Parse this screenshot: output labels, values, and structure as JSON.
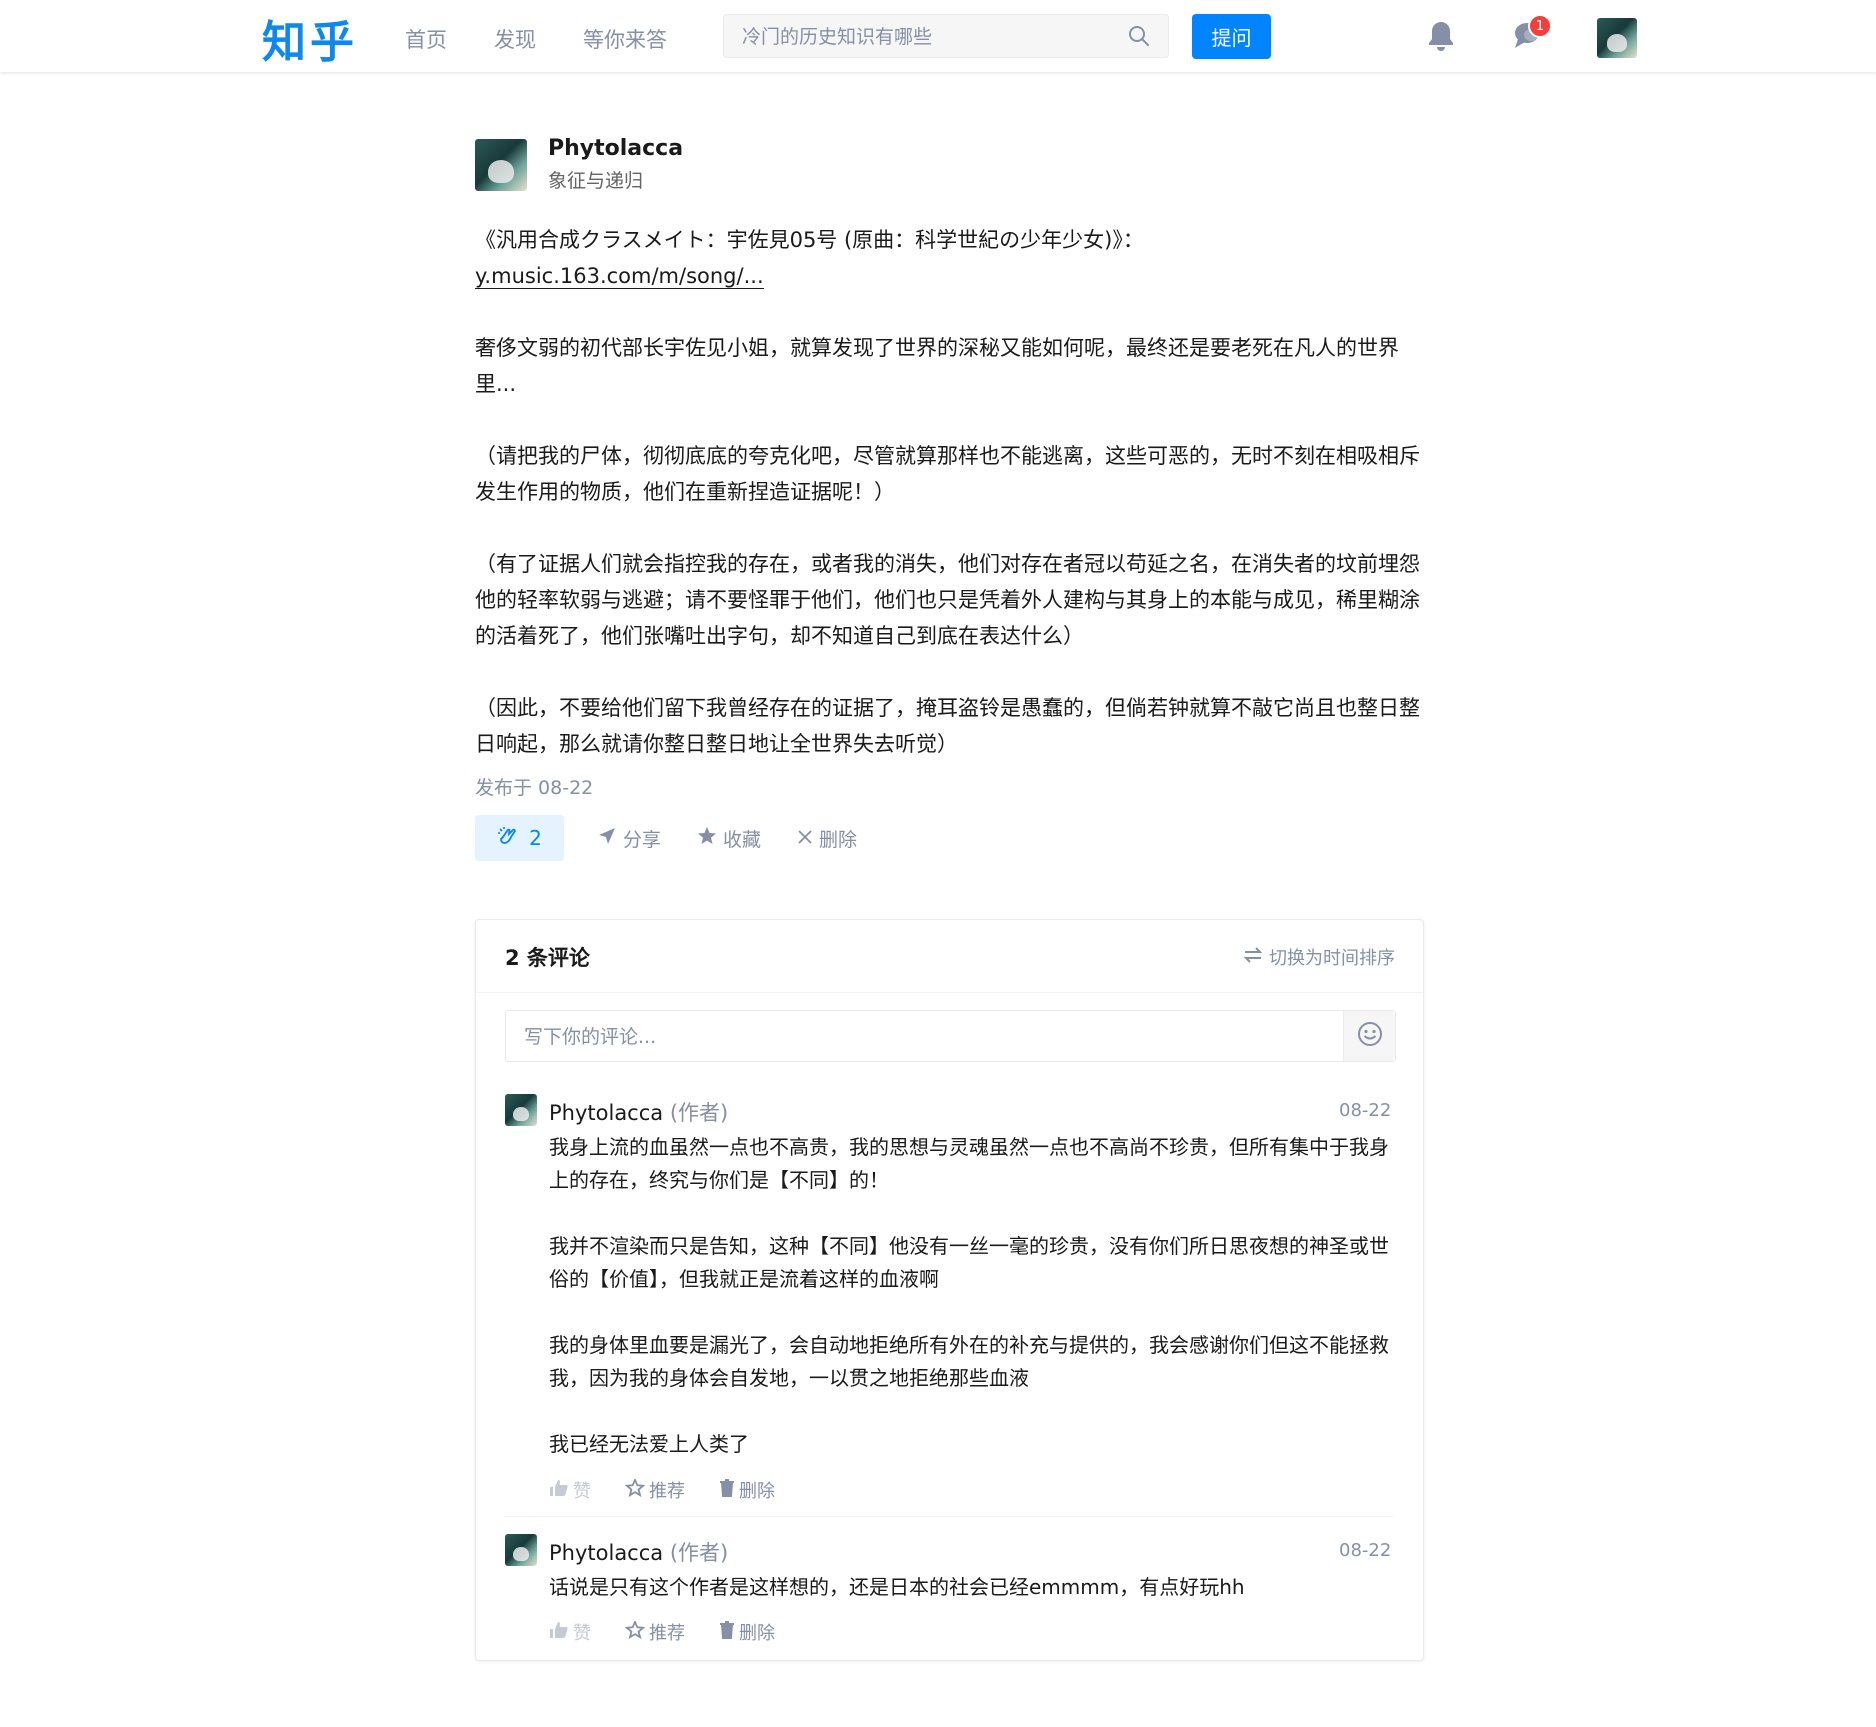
{
  "header": {
    "logo": "知乎",
    "nav": [
      "首页",
      "发现",
      "等你来答"
    ],
    "search_placeholder": "冷门的历史知识有哪些",
    "ask_label": "提问",
    "message_badge": "1"
  },
  "post": {
    "author_name": "Phytolacca",
    "author_bio": "象征与递归",
    "song_line": "《汎用合成クラスメイト：宇佐見05号 (原曲：科学世紀の少年少女)》：",
    "link_text": "y.music.163.com/m/song/...",
    "paragraphs": [
      "奢侈文弱的初代部长宇佐见小姐，就算发现了世界的深秘又能如何呢，最终还是要老死在凡人的世界里...",
      "（请把我的尸体，彻彻底底的夸克化吧，尽管就算那样也不能逃离，这些可恶的，无时不刻在相吸相斥发生作用的物质，他们在重新捏造证据呢！）",
      "（有了证据人们就会指控我的存在，或者我的消失，他们对存在者冠以苟延之名，在消失者的坟前埋怨他的轻率软弱与逃避；请不要怪罪于他们，他们也只是凭着外人建构与其身上的本能与成见，稀里糊涂的活着死了，他们张嘴吐出字句，却不知道自己到底在表达什么）",
      "（因此，不要给他们留下我曾经存在的证据了，掩耳盗铃是愚蠢的，但倘若钟就算不敲它尚且也整日整日响起，那么就请你整日整日地让全世界失去听觉）"
    ],
    "published": "发布于 08-22",
    "clap_count": "2",
    "share_label": "分享",
    "collect_label": "收藏",
    "delete_label": "删除"
  },
  "comments": {
    "title": "2 条评论",
    "sort_label": "切换为时间排序",
    "input_placeholder": "写下你的评论...",
    "items": [
      {
        "name": "Phytolacca",
        "role": "(作者)",
        "date": "08-22",
        "paragraphs": [
          "我身上流的血虽然一点也不高贵，我的思想与灵魂虽然一点也不高尚不珍贵，但所有集中于我身上的存在，终究与你们是【不同】的！",
          "我并不渲染而只是告知，这种【不同】他没有一丝一毫的珍贵，没有你们所日思夜想的神圣或世俗的【价值】，但我就正是流着这样的血液啊",
          "我的身体里血要是漏光了，会自动地拒绝所有外在的补充与提供的，我会感谢你们但这不能拯救我，因为我的身体会自发地，一以贯之地拒绝那些血液",
          "我已经无法爱上人类了"
        ],
        "like_label": "赞",
        "recommend_label": "推荐",
        "delete_label": "删除"
      },
      {
        "name": "Phytolacca",
        "role": "(作者)",
        "date": "08-22",
        "text": "话说是只有这个作者是这样想的，还是日本的社会已经emmmm，有点好玩hh",
        "like_label": "赞",
        "recommend_label": "推荐",
        "delete_label": "删除"
      }
    ]
  },
  "colors": {
    "brand": "#0084ff",
    "muted": "#8590a6",
    "badge": "#f1403c"
  }
}
